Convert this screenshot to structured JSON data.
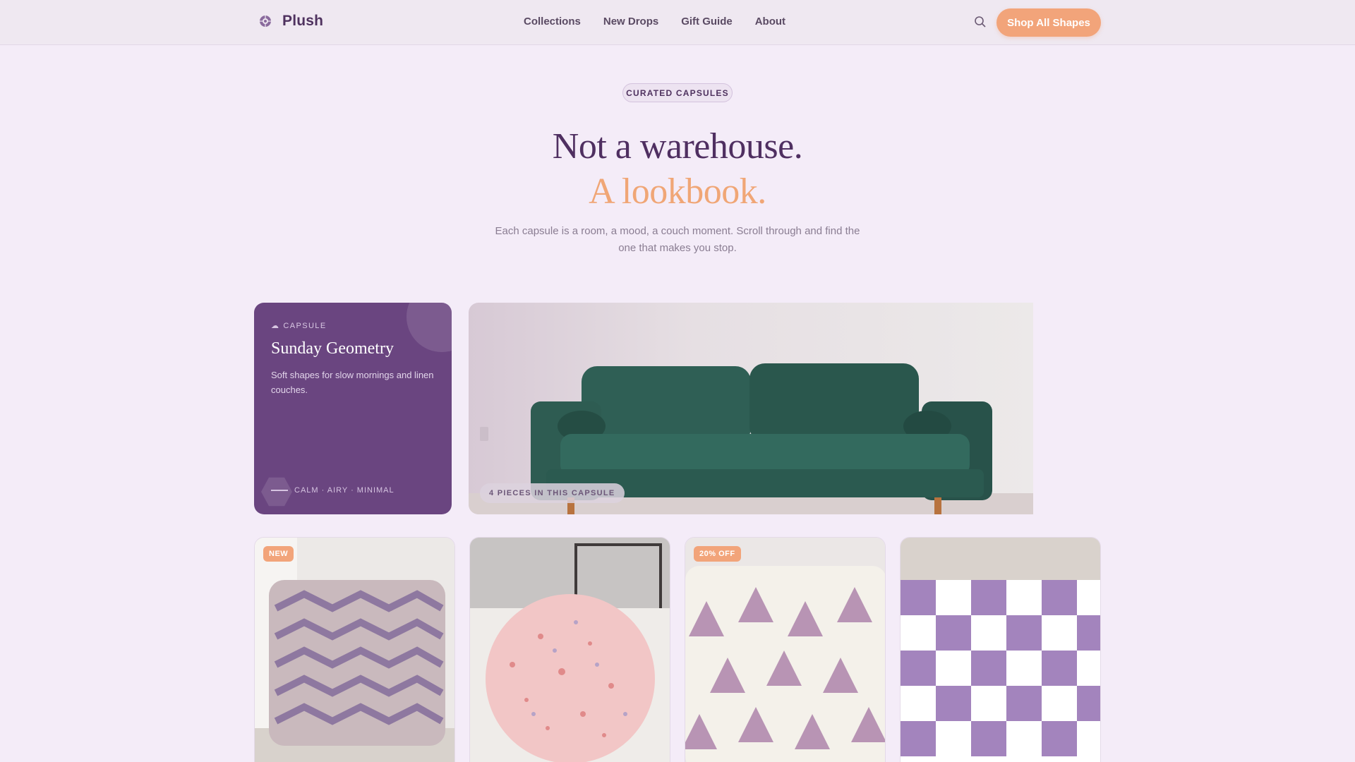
{
  "header": {
    "brand": "Plush",
    "nav": [
      "Collections",
      "New Drops",
      "Gift Guide",
      "About"
    ],
    "cta": "Shop All Shapes"
  },
  "hero": {
    "eyebrow": "CURATED CAPSULES",
    "title_line1": "Not a warehouse.",
    "title_line2": "A lookbook.",
    "lede": "Each capsule is a room, a mood, a couch moment. Scroll through and find the one that makes you stop."
  },
  "capsule": {
    "label": "CAPSULE",
    "title": "Sunday Geometry",
    "description": "Soft shapes for slow mornings and linen couches.",
    "tags": "CALM · AIRY · MINIMAL",
    "pieces": "4 PIECES IN THIS CAPSULE"
  },
  "products": [
    {
      "badge": "NEW",
      "icon": "geometric-pillow-image"
    },
    {
      "badge": "",
      "icon": "round-terrazzo-pillow-image"
    },
    {
      "badge": "20% OFF",
      "icon": "triangle-pillow-image"
    },
    {
      "badge": "",
      "icon": "checkered-pillow-image"
    }
  ],
  "colors": {
    "background": "#f4ecf8",
    "accent": "#f2a47a",
    "primary": "#4f2f61",
    "capsule_card": "#6a4580",
    "sofa": "#2d5c52"
  }
}
